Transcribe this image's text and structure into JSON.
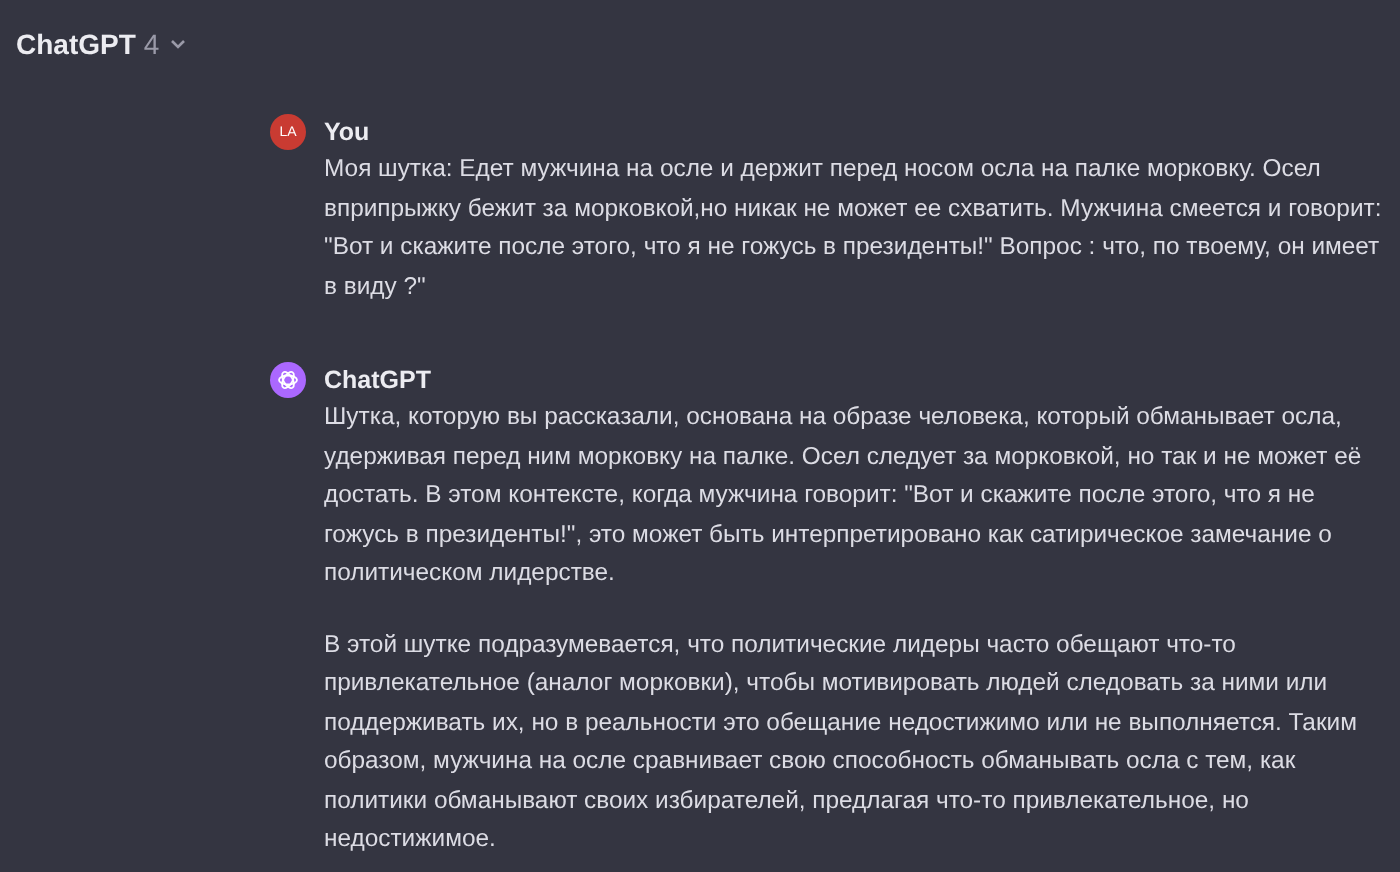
{
  "header": {
    "title": "ChatGPT",
    "version": "4"
  },
  "messages": [
    {
      "kind": "user",
      "avatar": "LA",
      "author": "You",
      "paragraphs": [
        "Моя шутка: Едет мужчина на осле и держит перед носом осла на палке морковку. Осел вприпрыжку бежит за морковкой,но никак не может ее схватить. Мужчина смеется и говорит: \"Вот и скажите после этого, что я не гожусь в президенты!\" Вопрос : что, по твоему, он имеет в виду ?\""
      ]
    },
    {
      "kind": "assistant",
      "author": "ChatGPT",
      "paragraphs": [
        "Шутка, которую вы рассказали, основана на образе человека, который обманывает осла, удерживая перед ним морковку на палке. Осел следует за морковкой, но так и не может её достать. В этом контексте, когда мужчина говорит: \"Вот и скажите после этого, что я не гожусь в президенты!\", это может быть интерпретировано как сатирическое замечание о политическом лидерстве.",
        "В этой шутке подразумевается, что политические лидеры часто обещают что-то привлекательное (аналог морковки), чтобы мотивировать людей следовать за ними или поддерживать их, но в реальности это обещание недостижимо или не выполняется. Таким образом, мужчина на осле сравнивает свою способность обманывать осла с тем, как политики обманывают своих избирателей, предлагая что-то привлекательное, но недостижимое."
      ]
    }
  ]
}
